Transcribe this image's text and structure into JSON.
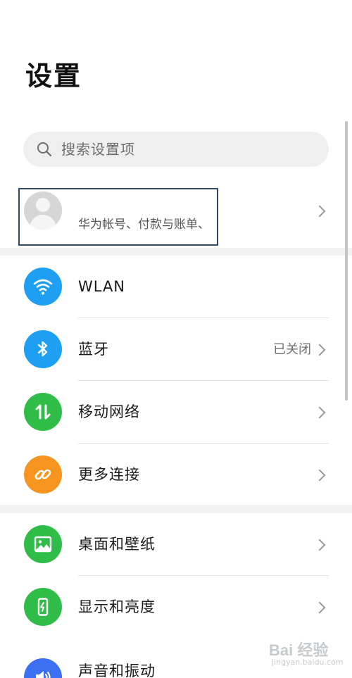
{
  "page": {
    "title": "设置"
  },
  "search": {
    "placeholder": "搜索设置项",
    "icon": "search-icon"
  },
  "account": {
    "subtitle": "华为帐号、付款与账单、"
  },
  "sections": [
    {
      "items": [
        {
          "id": "wlan",
          "label": "WLAN",
          "value": "",
          "icon": "wifi-icon",
          "color": "#1e9ff2"
        },
        {
          "id": "bluetooth",
          "label": "蓝牙",
          "value": "已关闭",
          "icon": "bluetooth-icon",
          "color": "#1e9ff2"
        },
        {
          "id": "mobile-network",
          "label": "移动网络",
          "value": "",
          "icon": "mobile-data-icon",
          "color": "#2fbd48"
        },
        {
          "id": "more-connections",
          "label": "更多连接",
          "value": "",
          "icon": "link-icon",
          "color": "#f5941e"
        }
      ]
    },
    {
      "items": [
        {
          "id": "wallpaper",
          "label": "桌面和壁纸",
          "value": "",
          "icon": "picture-icon",
          "color": "#2fbd48"
        },
        {
          "id": "display",
          "label": "显示和亮度",
          "value": "",
          "icon": "display-brightness-icon",
          "color": "#2fbd48"
        },
        {
          "id": "sound",
          "label": "声音和振动",
          "value": "",
          "icon": "speaker-icon",
          "color": "#3d6ff2"
        }
      ]
    }
  ],
  "watermark": {
    "brand": "Bai 经验",
    "sub": "jingyan.baidu.com"
  }
}
